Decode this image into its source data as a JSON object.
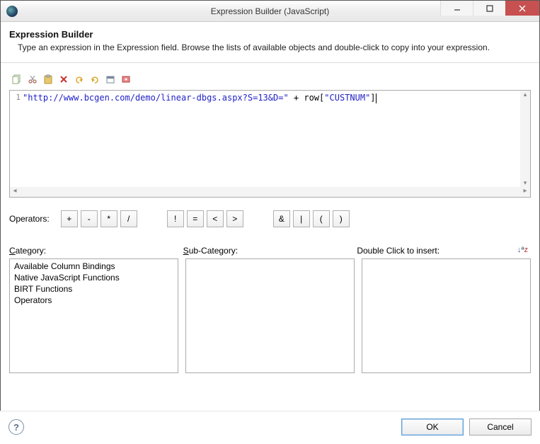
{
  "window": {
    "title": "Expression Builder (JavaScript)"
  },
  "header": {
    "title": "Expression Builder",
    "subtitle": "Type an expression in the Expression field. Browse the lists of available objects and double-click to copy into your expression."
  },
  "toolbar_icons": [
    "copy",
    "cut",
    "paste",
    "delete",
    "undo",
    "redo",
    "calendar",
    "validate"
  ],
  "editor": {
    "line_number": "1",
    "string_literal": "\"http://www.bcgen.com/demo/linear-dbgs.aspx?S=13&D=\"",
    "between": " + row[",
    "field_literal": "\"CUSTNUM\"",
    "tail": "]"
  },
  "operators": {
    "label": "Operators:",
    "groups": [
      [
        "+",
        "-",
        "*",
        "/"
      ],
      [
        "!",
        "=",
        "<",
        ">"
      ],
      [
        "&",
        "|",
        "(",
        ")"
      ]
    ]
  },
  "labels": {
    "category": "Category:",
    "subcategory": "Sub-Category:",
    "insert": "Double Click to insert:"
  },
  "categories": [
    "Available Column Bindings",
    "Native JavaScript Functions",
    "BIRT Functions",
    "Operators"
  ],
  "subcategories": [],
  "insert_items": [],
  "buttons": {
    "ok": "OK",
    "cancel": "Cancel"
  }
}
